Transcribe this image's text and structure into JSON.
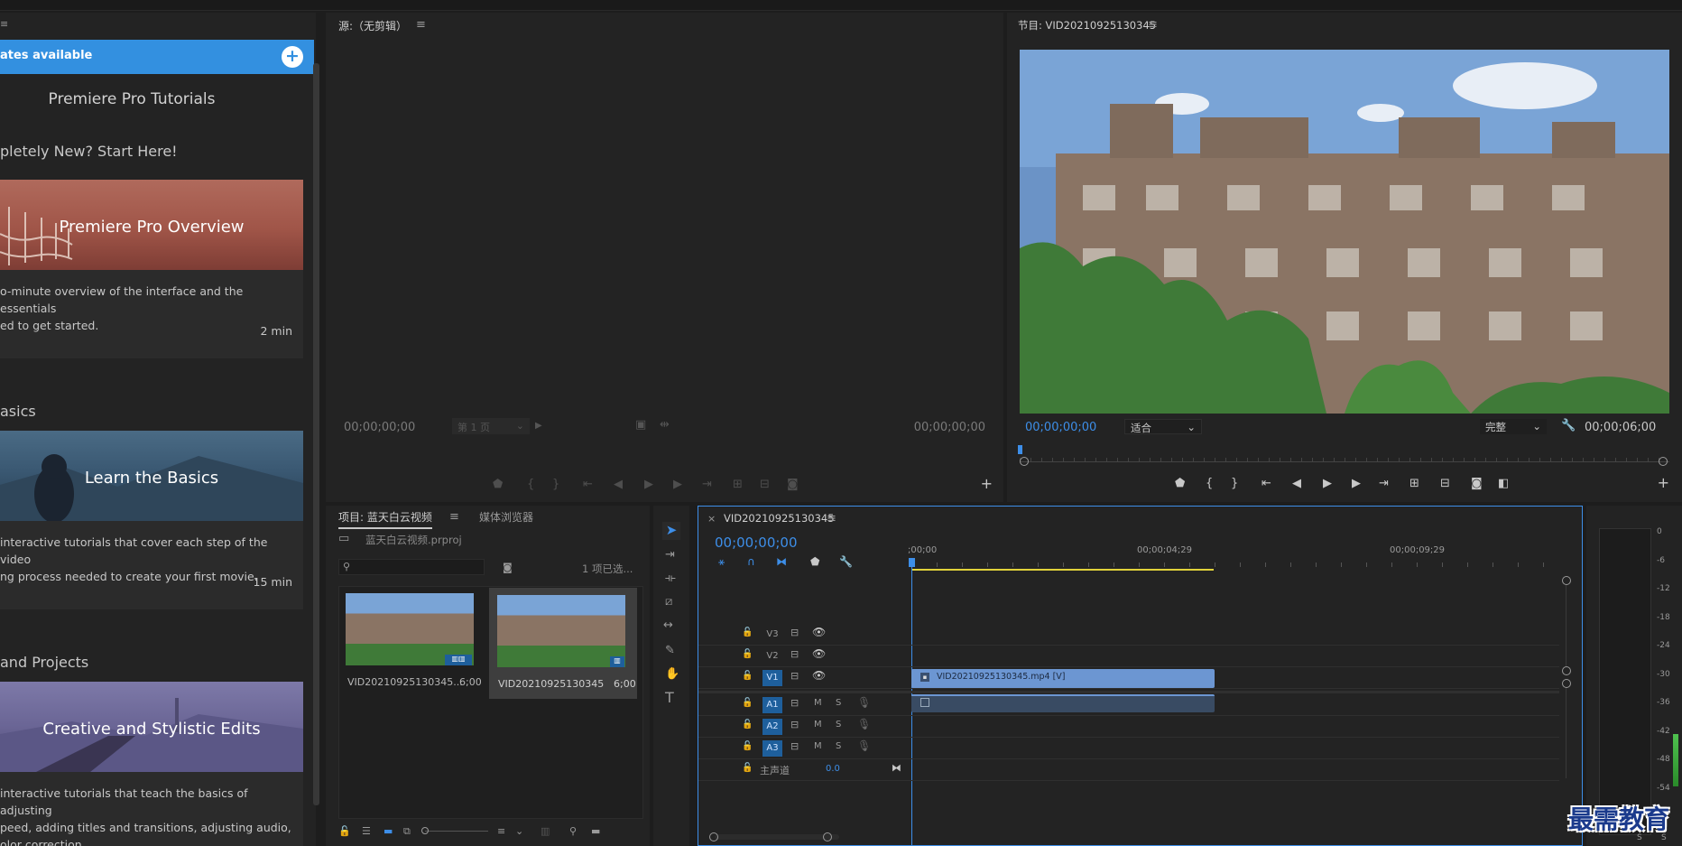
{
  "learn": {
    "updates_label": "ates available",
    "add_icon": "plus-circle-icon",
    "title": "Premiere Pro Tutorials",
    "intro_heading": "pletely New? Start Here!",
    "cards": [
      {
        "title": "Premiere Pro Overview",
        "desc1": "o-minute overview of the interface and the essentials",
        "desc2": "ed to get started.",
        "duration": "2 min"
      },
      {
        "title": "Learn the Basics",
        "desc1": "interactive tutorials that cover each step of the video",
        "desc2": "ng process needed to create your first movie.",
        "duration": "15 min"
      },
      {
        "title": "Creative and Stylistic Edits",
        "desc1": "interactive tutorials that teach the basics of adjusting",
        "desc2": "peed, adding titles and transitions, adjusting audio,",
        "desc3": "olor correction.",
        "duration": ""
      }
    ],
    "sections": [
      "asics",
      "and Projects"
    ]
  },
  "source": {
    "title": "源:（无剪辑）",
    "timecode_left": "00;00;00;00",
    "page_select": "第 1 页",
    "timecode_right": "00;00;00;00"
  },
  "program": {
    "title": "节目: VID20210925130345",
    "timecode": "00;00;00;00",
    "fit": "适合",
    "quality": "完整",
    "duration": "00;00;06;00"
  },
  "project": {
    "tab": "项目: 蓝天白云视频",
    "tab2": "媒体浏览器",
    "file": "蓝天白云视频.prproj",
    "selected": "1 项已选...",
    "items": [
      {
        "name": "VID20210925130345...",
        "dur": "6;00"
      },
      {
        "name": "VID20210925130345",
        "dur": "6;00"
      }
    ]
  },
  "timeline": {
    "title": "VID20210925130345",
    "timecode": "00;00;00;00",
    "ruler": [
      ";00;00",
      "00;00;04;29",
      "00;00;09;29"
    ],
    "video_tracks": [
      "V3",
      "V2",
      "V1"
    ],
    "audio_tracks": [
      "A1",
      "A2",
      "A3"
    ],
    "clip_label": "VID20210925130345.mp4 [V]",
    "master": "主声道",
    "master_val": "0.0",
    "m_label": "M",
    "s_label": "S"
  },
  "meter": {
    "scale": [
      "0",
      "-6",
      "-12",
      "-18",
      "-24",
      "-30",
      "-36",
      "-42",
      "-48",
      "-54"
    ],
    "footer": [
      "S",
      "S"
    ]
  },
  "watermark": "最需教育",
  "colors": {
    "accent": "#3390e0",
    "clip": "#6c96d2",
    "timecode": "#3d8ee8"
  }
}
